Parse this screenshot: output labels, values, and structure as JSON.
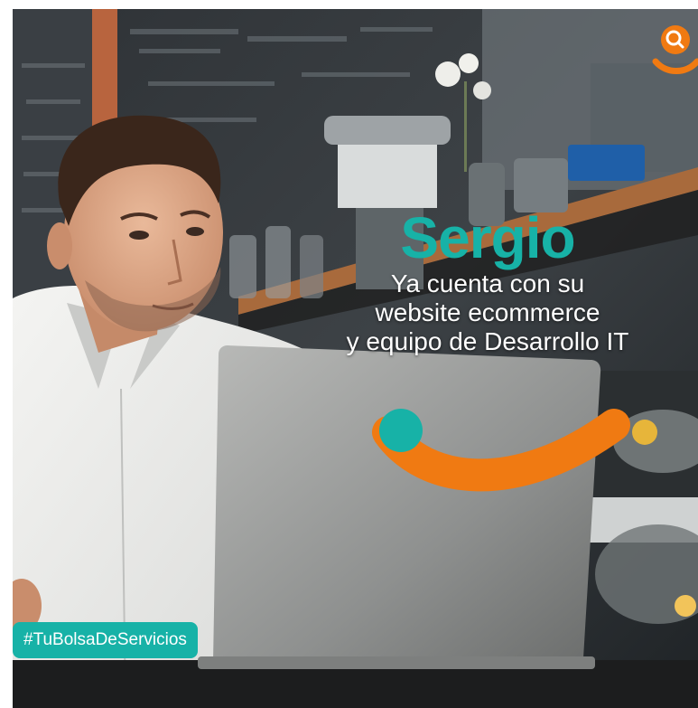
{
  "colors": {
    "teal": "#17b2a7",
    "orange": "#f07a12",
    "white": "#ffffff"
  },
  "icons": {
    "brand_logo": "orange-magnifier-smile-icon",
    "swoosh": "teal-dot-orange-smile-swoosh"
  },
  "post": {
    "name": "Sergio",
    "tagline_lines": [
      "Ya cuenta con su",
      "website ecommerce",
      "y equipo de Desarrollo IT"
    ],
    "hashtag": "#TuBolsaDeServicios"
  }
}
